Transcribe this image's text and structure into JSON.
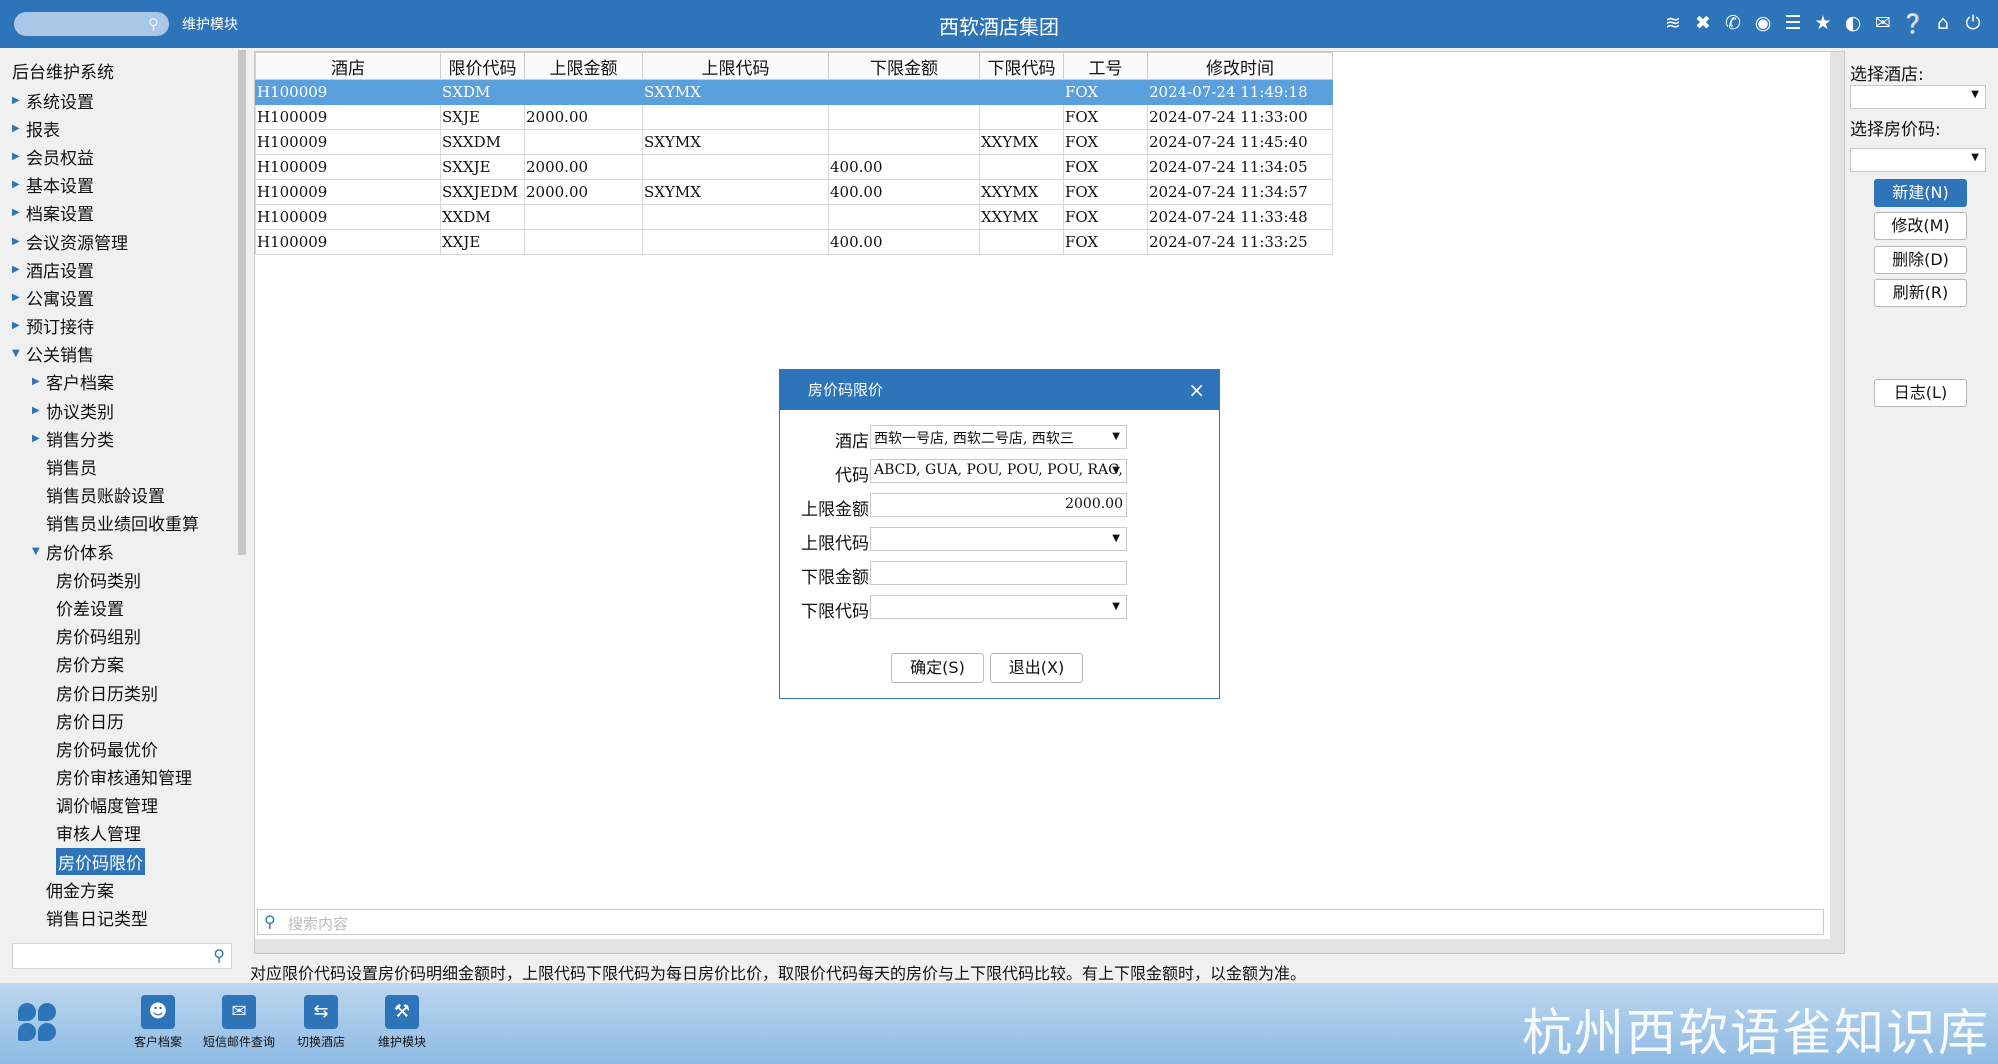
{
  "titlebar": {
    "module": "维护模块",
    "title": "西软酒店集团",
    "icons": [
      "wifi-icon",
      "tools-icon",
      "phone-icon",
      "palette-icon",
      "menu-icon",
      "star-icon",
      "contrast-icon",
      "mail-icon",
      "help-icon",
      "home-icon",
      "power-icon"
    ]
  },
  "sidebar": {
    "header": "后台维护系统",
    "items": [
      {
        "label": "系统设置",
        "level": 1,
        "arrow": "right"
      },
      {
        "label": "报表",
        "level": 1,
        "arrow": "right"
      },
      {
        "label": "会员权益",
        "level": 1,
        "arrow": "right"
      },
      {
        "label": "基本设置",
        "level": 1,
        "arrow": "right"
      },
      {
        "label": "档案设置",
        "level": 1,
        "arrow": "right"
      },
      {
        "label": "会议资源管理",
        "level": 1,
        "arrow": "right"
      },
      {
        "label": "酒店设置",
        "level": 1,
        "arrow": "right"
      },
      {
        "label": "公寓设置",
        "level": 1,
        "arrow": "right"
      },
      {
        "label": "预订接待",
        "level": 1,
        "arrow": "right"
      },
      {
        "label": "公关销售",
        "level": 1,
        "arrow": "down"
      },
      {
        "label": "客户档案",
        "level": 2,
        "arrow": "right"
      },
      {
        "label": "协议类别",
        "level": 2,
        "arrow": "right"
      },
      {
        "label": "销售分类",
        "level": 2,
        "arrow": "right"
      },
      {
        "label": "销售员",
        "level": 2,
        "arrow": ""
      },
      {
        "label": "销售员账龄设置",
        "level": 2,
        "arrow": ""
      },
      {
        "label": "销售员业绩回收重算",
        "level": 2,
        "arrow": ""
      },
      {
        "label": "房价体系",
        "level": 2,
        "arrow": "down"
      },
      {
        "label": "房价码类别",
        "level": 3,
        "arrow": ""
      },
      {
        "label": "价差设置",
        "level": 3,
        "arrow": ""
      },
      {
        "label": "房价码组别",
        "level": 3,
        "arrow": ""
      },
      {
        "label": "房价方案",
        "level": 3,
        "arrow": ""
      },
      {
        "label": "房价日历类别",
        "level": 3,
        "arrow": ""
      },
      {
        "label": "房价日历",
        "level": 3,
        "arrow": ""
      },
      {
        "label": "房价码最优价",
        "level": 3,
        "arrow": ""
      },
      {
        "label": "房价审核通知管理",
        "level": 3,
        "arrow": ""
      },
      {
        "label": "调价幅度管理",
        "level": 3,
        "arrow": ""
      },
      {
        "label": "审核人管理",
        "level": 3,
        "arrow": ""
      },
      {
        "label": "房价码限价",
        "level": 3,
        "arrow": "",
        "selected": true
      },
      {
        "label": "佣金方案",
        "level": 2,
        "arrow": ""
      },
      {
        "label": "销售日记类型",
        "level": 2,
        "arrow": ""
      }
    ]
  },
  "grid": {
    "columns": [
      "酒店",
      "限价代码",
      "上限金额",
      "上限代码",
      "下限金额",
      "下限代码",
      "工号",
      "修改时间"
    ],
    "rows": [
      [
        "H100009",
        "SXDM",
        "",
        "SXYMX",
        "",
        "",
        "FOX",
        "2024-07-24 11:49:18"
      ],
      [
        "H100009",
        "SXJE",
        "2000.00",
        "",
        "",
        "",
        "FOX",
        "2024-07-24 11:33:00"
      ],
      [
        "H100009",
        "SXXDM",
        "",
        "SXYMX",
        "",
        "XXYMX",
        "FOX",
        "2024-07-24 11:45:40"
      ],
      [
        "H100009",
        "SXXJE",
        "2000.00",
        "",
        "400.00",
        "",
        "FOX",
        "2024-07-24 11:34:05"
      ],
      [
        "H100009",
        "SXXJEDM",
        "2000.00",
        "SXYMX",
        "400.00",
        "XXYMX",
        "FOX",
        "2024-07-24 11:34:57"
      ],
      [
        "H100009",
        "XXDM",
        "",
        "",
        "",
        "XXYMX",
        "FOX",
        "2024-07-24 11:33:48"
      ],
      [
        "H100009",
        "XXJE",
        "",
        "",
        "400.00",
        "",
        "FOX",
        "2024-07-24 11:33:25"
      ]
    ],
    "selected_row": 0,
    "search_placeholder": "搜索内容"
  },
  "right_panel": {
    "hotel_label": "选择酒店:",
    "hotel_value": "",
    "ratecode_label": "选择房价码:",
    "ratecode_value": "",
    "new_button": "新建(N)",
    "edit_button": "修改(M)",
    "delete_button": "删除(D)",
    "refresh_button": "刷新(R)",
    "log_button": "日志(L)"
  },
  "dialog": {
    "title": "房价码限价",
    "fields": [
      {
        "label": "酒店",
        "value": "西软一号店, 西软二号店, 西软三",
        "type": "select"
      },
      {
        "label": "代码",
        "value": "ABCD, GUA, POU, POU, POU, RAC, RIO",
        "type": "select"
      },
      {
        "label": "上限金额",
        "value": "2000.00",
        "type": "number"
      },
      {
        "label": "上限代码",
        "value": "",
        "type": "select"
      },
      {
        "label": "下限金额",
        "value": "",
        "type": "text"
      },
      {
        "label": "下限代码",
        "value": "",
        "type": "select"
      }
    ],
    "ok_button": "确定(S)",
    "exit_button": "退出(X)"
  },
  "hint": "对应限价代码设置房价码明细金额时，上限代码下限代码为每日房价比价，取限价代码每天的房价与上下限代码比较。有上下限金额时，以金额为准。",
  "taskbar": {
    "items": [
      {
        "label": "客户档案",
        "icon": "person-card-icon"
      },
      {
        "label": "短信邮件查询",
        "icon": "mail-icon"
      },
      {
        "label": "切换酒店",
        "icon": "switch-icon"
      },
      {
        "label": "维护模块",
        "icon": "wrench-icon"
      }
    ],
    "watermark": "杭州西软语雀知识库"
  },
  "colors": {
    "primary": "#2e74b8",
    "selection": "#5aa0dc"
  }
}
